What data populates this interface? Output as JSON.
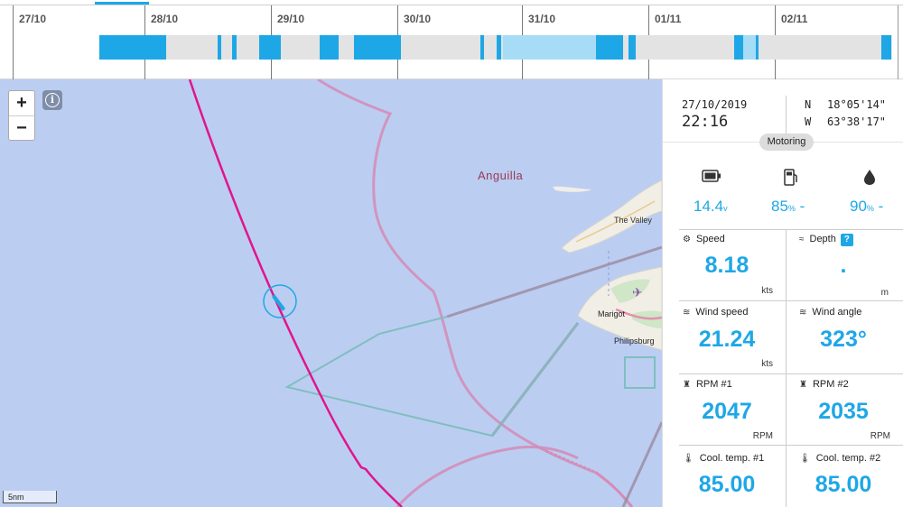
{
  "timeline": {
    "days": [
      "27/10",
      "28/10",
      "29/10",
      "30/10",
      "31/10",
      "01/11",
      "02/11"
    ]
  },
  "map": {
    "zoom_in_label": "+",
    "zoom_out_label": "−",
    "info_label": "i",
    "labels": {
      "anguilla": "Anguilla",
      "the_valley": "The Valley",
      "marigot": "Marigot",
      "philipsburg": "Philipsburg"
    },
    "scale": "5nm",
    "colors": {
      "water": "#bccdf2",
      "track": "#e0158c",
      "boat_marker": "#1ea7e6",
      "boundary": "#d48bb5",
      "zone": "#7fbfbf"
    }
  },
  "panel": {
    "date": "27/10/2019",
    "time": "22:16",
    "lat_hemisphere": "N",
    "lat": "18°05'14\"",
    "lon_hemisphere": "W",
    "lon": "63°38'17\"",
    "status": "Motoring",
    "gauges": {
      "battery": {
        "icon": "battery-icon",
        "value": "14.4",
        "unit": "v"
      },
      "fuel": {
        "icon": "fuel-pump-icon",
        "value": "85",
        "unit": "%",
        "suffix": "-"
      },
      "water": {
        "icon": "water-drop-icon",
        "value": "90",
        "unit": "%",
        "suffix": "-"
      }
    },
    "metrics": {
      "speed": {
        "label": "Speed",
        "value": "8.18",
        "unit": "kts",
        "icon": "speedometer-icon"
      },
      "depth": {
        "label": "Depth",
        "value": ".",
        "unit": "m",
        "help": "?",
        "icon": "wave-icon"
      },
      "wind_speed": {
        "label": "Wind speed",
        "value": "21.24",
        "unit": "kts",
        "icon": "wind-icon"
      },
      "wind_angle": {
        "label": "Wind angle",
        "value": "323°",
        "icon": "wind-icon"
      },
      "rpm1": {
        "label": "RPM #1",
        "value": "2047",
        "unit": "RPM",
        "icon": "engine-icon"
      },
      "rpm2": {
        "label": "RPM #2",
        "value": "2035",
        "unit": "RPM",
        "icon": "engine-icon"
      },
      "cool1": {
        "label": "Cool. temp. #1",
        "value": "85.00",
        "icon": "thermometer-icon"
      },
      "cool2": {
        "label": "Cool. temp. #2",
        "value": "85.00",
        "icon": "thermometer-icon"
      }
    }
  }
}
